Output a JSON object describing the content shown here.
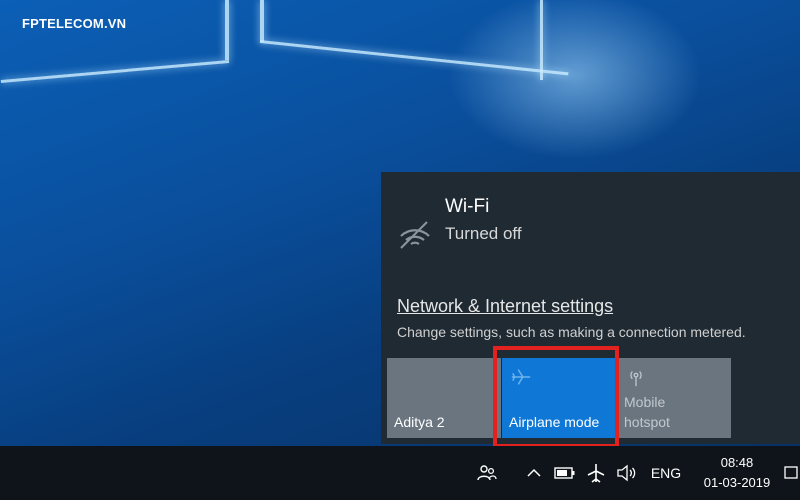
{
  "watermark": "FPTELECOM.VN",
  "wifi": {
    "title": "Wi-Fi",
    "status": "Turned off",
    "icon": "wifi-off-icon"
  },
  "network": {
    "settings_link": "Network & Internet settings",
    "description": "Change settings, such as making a connection metered."
  },
  "tiles": [
    {
      "label": "Aditya 2",
      "state": "off"
    },
    {
      "label": "Airplane mode",
      "icon": "airplane-icon",
      "state": "on",
      "color": "#0f78d7"
    },
    {
      "label_line1": "Mobile",
      "label_line2": "hotspot",
      "icon": "hotspot-icon",
      "state": "off"
    }
  ],
  "taskbar": {
    "language": "ENG",
    "time": "08:48",
    "date": "01-03-2019",
    "icons": [
      "people-icon",
      "chevron-up-icon",
      "battery-icon",
      "airplane-icon",
      "volume-icon",
      "notification-icon"
    ]
  },
  "highlight_color": "#e2221e"
}
